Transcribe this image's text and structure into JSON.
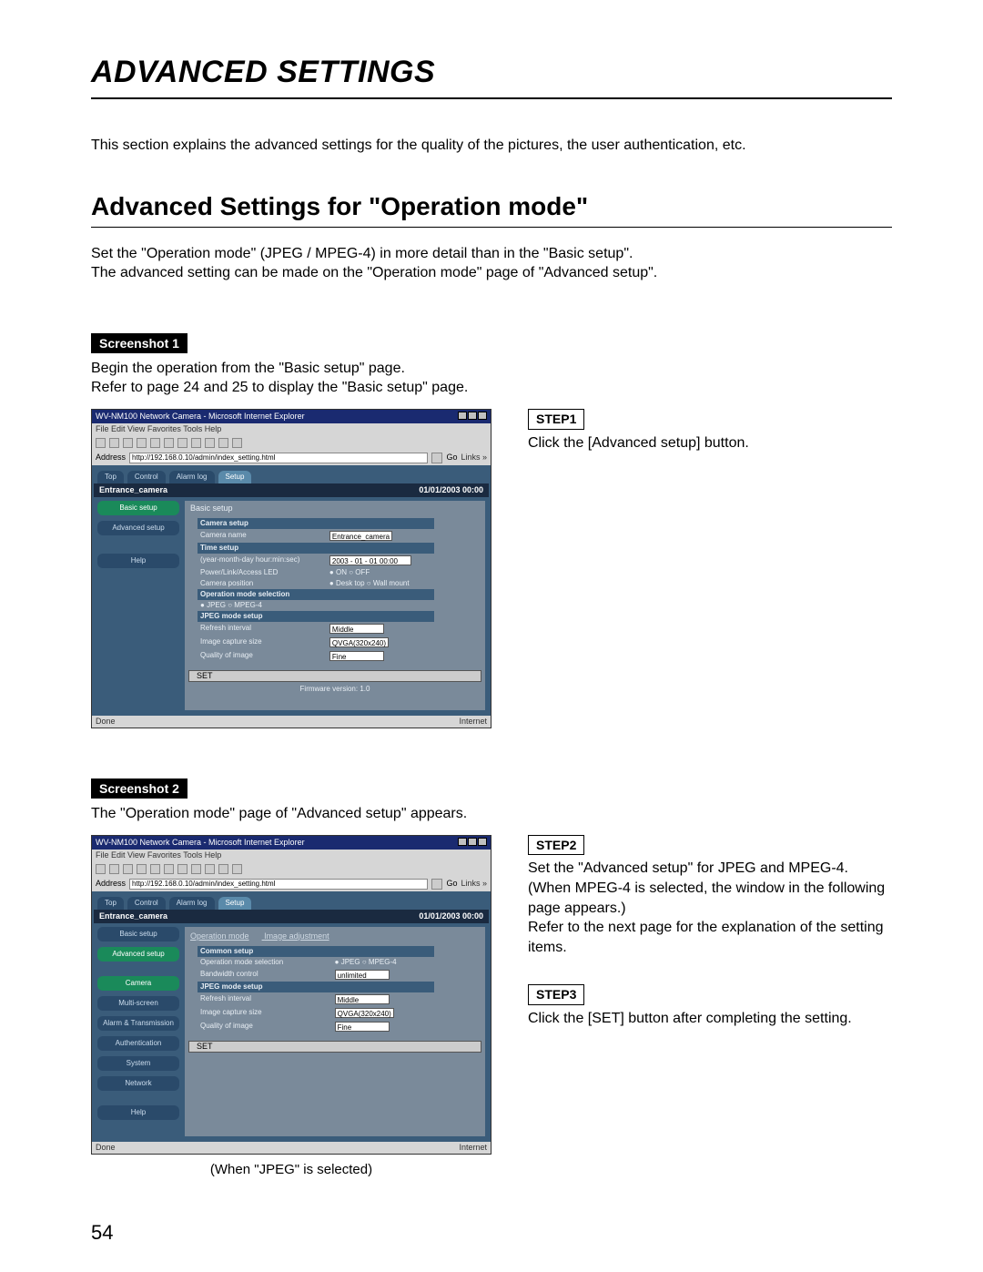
{
  "page_title": "ADVANCED SETTINGS",
  "intro": "This section explains the advanced settings for the quality of the pictures, the user authentication, etc.",
  "section_title": "Advanced Settings for \"Operation mode\"",
  "section_body": "Set the \"Operation mode\" (JPEG / MPEG-4) in more detail than in the \"Basic setup\".\nThe advanced setting can be made on the \"Operation mode\" page of \"Advanced setup\".",
  "page_number": "54",
  "screenshot1": {
    "badge": "Screenshot 1",
    "caption": "Begin the operation from the \"Basic setup\" page.\nRefer to page 24 and 25 to display the \"Basic setup\" page."
  },
  "screenshot2": {
    "badge": "Screenshot 2",
    "caption": "The \"Operation mode\" page of \"Advanced setup\" appears.",
    "figcap": "(When \"JPEG\" is selected)"
  },
  "steps": {
    "s1": {
      "label": "STEP1",
      "text": "Click the [Advanced setup] button."
    },
    "s2": {
      "label": "STEP2",
      "text": "Set the \"Advanced setup\" for JPEG and MPEG-4. (When MPEG-4 is selected, the window in the following page appears.)\nRefer to the next page for the explanation of the setting items."
    },
    "s3": {
      "label": "STEP3",
      "text": "Click the [SET] button after completing the setting."
    }
  },
  "shot_common": {
    "win_title": "WV-NM100 Network Camera - Microsoft Internet Explorer",
    "menubar": "File  Edit  View  Favorites  Tools  Help",
    "address_label": "Address",
    "go": "Go",
    "links": "Links »",
    "url": "http://192.168.0.10/admin/index_setting.html",
    "tabs": {
      "top": "Top",
      "control": "Control",
      "alarm_log": "Alarm log",
      "setup": "Setup"
    },
    "camera_title": "Entrance_camera",
    "datetime": "01/01/2003  00:00",
    "set": "SET",
    "firmware": "Firmware version: 1.0",
    "status_done": "Done",
    "status_net": "Internet"
  },
  "shot1": {
    "subtabs": {
      "basic": "Basic setup",
      "advanced": "Advanced setup"
    },
    "side": {
      "help": "Help"
    },
    "panel_title": "Basic setup",
    "rows": {
      "camera_setup": "Camera setup",
      "camera_name": "Camera name",
      "camera_name_val": "Entrance_camera",
      "time_setup": "Time setup",
      "time_label": "(year-month-day hour:min:sec)",
      "time_val1": "2003 - 01 - 01  00:00",
      "led": "Power/Link/Access LED",
      "led_on": "ON",
      "led_off": "OFF",
      "campos": "Camera position",
      "campos_a": "Desk top",
      "campos_b": "Wall mount",
      "opmode": "Operation mode selection",
      "opmode_a": "JPEG",
      "opmode_b": "MPEG-4",
      "jpeg": "JPEG mode setup",
      "refresh": "Refresh interval",
      "refresh_val": "Middle",
      "capsize": "Image capture size",
      "capsize_val": "QVGA(320x240)",
      "quality": "Quality of image",
      "quality_val": "Fine"
    }
  },
  "shot2": {
    "subtabs": {
      "basic": "Basic setup",
      "advanced": "Advanced setup"
    },
    "side": {
      "camera": "Camera",
      "multi": "Multi-screen",
      "alarm": "Alarm & Transmission",
      "auth": "Authentication",
      "system": "System",
      "network": "Network",
      "help": "Help"
    },
    "panel_tabs": {
      "op": "Operation mode",
      "imgadj": "Image adjustment"
    },
    "rows": {
      "common": "Common setup",
      "opmode": "Operation mode selection",
      "opmode_a": "JPEG",
      "opmode_b": "MPEG-4",
      "bw": "Bandwidth control",
      "bw_val": "unlimited",
      "jpeg": "JPEG mode setup",
      "refresh": "Refresh interval",
      "refresh_val": "Middle",
      "capsize": "Image capture size",
      "capsize_val": "QVGA(320x240)",
      "quality": "Quality of image",
      "quality_val": "Fine"
    }
  }
}
